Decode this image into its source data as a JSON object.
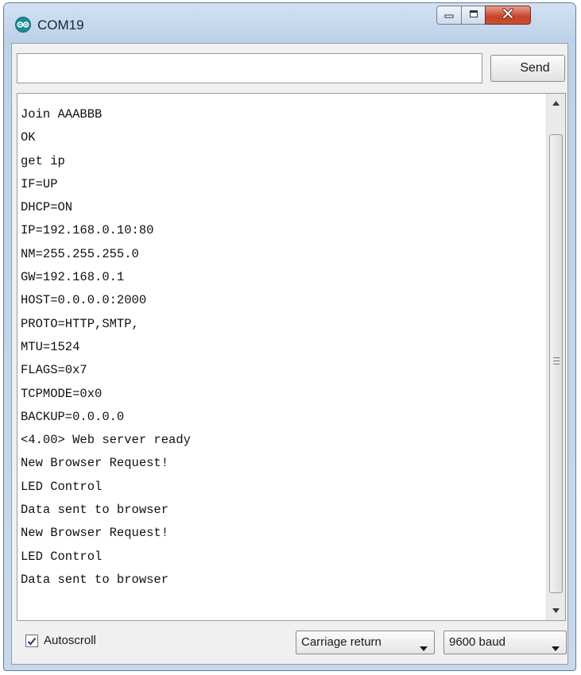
{
  "window": {
    "title": "COM19",
    "icon": "arduino-logo-icon"
  },
  "titlebar_controls": {
    "minimize_icon": "minimize-icon",
    "maximize_icon": "maximize-icon",
    "close_icon": "close-icon"
  },
  "send_bar": {
    "input_value": "",
    "send_label": "Send"
  },
  "output": {
    "lines": [
      "Join AAABBB",
      "OK",
      "get ip",
      "IF=UP",
      "DHCP=ON",
      "IP=192.168.0.10:80",
      "NM=255.255.255.0",
      "GW=192.168.0.1",
      "HOST=0.0.0.0:2000",
      "PROTO=HTTP,SMTP,",
      "MTU=1524",
      "FLAGS=0x7",
      "TCPMODE=0x0",
      "BACKUP=0.0.0.0",
      "<4.00> Web server ready",
      "New Browser Request!",
      "LED Control",
      "Data sent to browser",
      "New Browser Request!",
      "LED Control",
      "Data sent to browser"
    ]
  },
  "footer": {
    "autoscroll_label": "Autoscroll",
    "autoscroll_checked": true,
    "line_ending": "Carriage return",
    "baud_rate": "9600 baud"
  },
  "colors": {
    "titlebar": "#c4d6ea",
    "close_button": "#c7412a",
    "arduino_teal": "#1d8a9a"
  }
}
